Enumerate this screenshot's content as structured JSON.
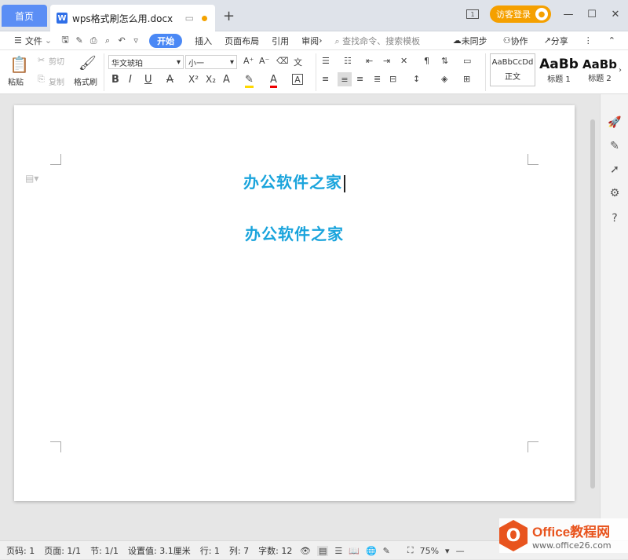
{
  "titlebar": {
    "home_tab": "首页",
    "doc_tab": "wps格式刷怎么用.docx",
    "new_tab": "+",
    "visitor_label": "访客登录"
  },
  "menu": {
    "file": "文件",
    "tabs": [
      "开始",
      "插入",
      "页面布局",
      "引用",
      "审阅"
    ],
    "search_placeholder": "查找命令、搜索模板",
    "unsync": "未同步",
    "collab": "协作",
    "share": "分享"
  },
  "ribbon": {
    "paste": "粘贴",
    "cut": "剪切",
    "copy": "复制",
    "format_painter": "格式刷",
    "font_name": "华文琥珀",
    "font_size": "小一",
    "styles": [
      {
        "preview": "AaBbCcDd",
        "name": "正文"
      },
      {
        "preview": "AaBb",
        "name": "标题 1"
      },
      {
        "preview": "AaBb",
        "name": "标题 2"
      }
    ]
  },
  "document": {
    "line1": "办公软件之家",
    "line2": "办公软件之家"
  },
  "status": {
    "page_no": "页码: 1",
    "pages": "页面: 1/1",
    "section": "节: 1/1",
    "setting": "设置值: 3.1厘米",
    "row": "行: 1",
    "col": "列: 7",
    "words": "字数: 12",
    "zoom": "75%"
  },
  "watermark": {
    "title": "Office教程网",
    "url": "www.office26.com"
  },
  "colors": {
    "accent": "#4a88f5",
    "doc_text": "#1aa4dc",
    "visitor": "#f5a000"
  }
}
